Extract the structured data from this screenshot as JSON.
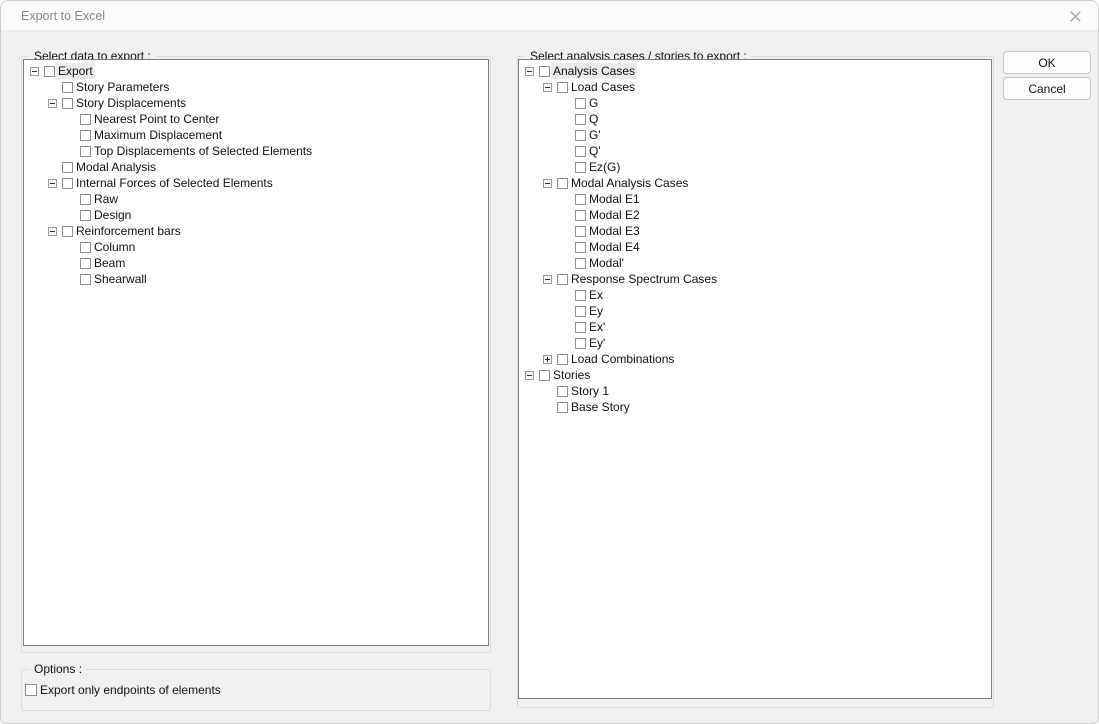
{
  "window": {
    "title": "Export to Excel",
    "close_icon": "close-icon"
  },
  "left_panel": {
    "legend": "Select data to export :",
    "tree": [
      {
        "label": "Export",
        "level": 0,
        "expander": "minus",
        "checked": false,
        "selected": true
      },
      {
        "label": "Story Parameters",
        "level": 1,
        "expander": "none",
        "checked": false,
        "selected": false
      },
      {
        "label": "Story Displacements",
        "level": 1,
        "expander": "minus",
        "checked": false,
        "selected": false
      },
      {
        "label": "Nearest Point to Center",
        "level": 2,
        "expander": "none",
        "checked": false,
        "selected": false
      },
      {
        "label": "Maximum Displacement",
        "level": 2,
        "expander": "none",
        "checked": false,
        "selected": false
      },
      {
        "label": "Top Displacements of Selected Elements",
        "level": 2,
        "expander": "none",
        "checked": false,
        "selected": false
      },
      {
        "label": "Modal Analysis",
        "level": 1,
        "expander": "none",
        "checked": false,
        "selected": false
      },
      {
        "label": "Internal Forces of Selected Elements",
        "level": 1,
        "expander": "minus",
        "checked": false,
        "selected": false
      },
      {
        "label": "Raw",
        "level": 2,
        "expander": "none",
        "checked": false,
        "selected": false
      },
      {
        "label": "Design",
        "level": 2,
        "expander": "none",
        "checked": false,
        "selected": false
      },
      {
        "label": "Reinforcement bars",
        "level": 1,
        "expander": "minus",
        "checked": false,
        "selected": false
      },
      {
        "label": "Column",
        "level": 2,
        "expander": "none",
        "checked": false,
        "selected": false
      },
      {
        "label": "Beam",
        "level": 2,
        "expander": "none",
        "checked": false,
        "selected": false
      },
      {
        "label": "Shearwall",
        "level": 2,
        "expander": "none",
        "checked": false,
        "selected": false
      }
    ]
  },
  "right_panel": {
    "legend": "Select analysis cases / stories to export :",
    "tree": [
      {
        "label": "Analysis Cases",
        "level": 0,
        "expander": "minus",
        "checked": false,
        "selected": true
      },
      {
        "label": "Load Cases",
        "level": 1,
        "expander": "minus",
        "checked": false,
        "selected": false
      },
      {
        "label": "G",
        "level": 2,
        "expander": "none",
        "checked": false,
        "selected": false
      },
      {
        "label": "Q",
        "level": 2,
        "expander": "none",
        "checked": false,
        "selected": false
      },
      {
        "label": "G'",
        "level": 2,
        "expander": "none",
        "checked": false,
        "selected": false
      },
      {
        "label": "Q'",
        "level": 2,
        "expander": "none",
        "checked": false,
        "selected": false
      },
      {
        "label": "Ez(G)",
        "level": 2,
        "expander": "none",
        "checked": false,
        "selected": false
      },
      {
        "label": "Modal Analysis Cases",
        "level": 1,
        "expander": "minus",
        "checked": false,
        "selected": false
      },
      {
        "label": "Modal E1",
        "level": 2,
        "expander": "none",
        "checked": false,
        "selected": false
      },
      {
        "label": "Modal E2",
        "level": 2,
        "expander": "none",
        "checked": false,
        "selected": false
      },
      {
        "label": "Modal E3",
        "level": 2,
        "expander": "none",
        "checked": false,
        "selected": false
      },
      {
        "label": "Modal E4",
        "level": 2,
        "expander": "none",
        "checked": false,
        "selected": false
      },
      {
        "label": "Modal'",
        "level": 2,
        "expander": "none",
        "checked": false,
        "selected": false
      },
      {
        "label": "Response Spectrum Cases",
        "level": 1,
        "expander": "minus",
        "checked": false,
        "selected": false
      },
      {
        "label": "Ex",
        "level": 2,
        "expander": "none",
        "checked": false,
        "selected": false
      },
      {
        "label": "Ey",
        "level": 2,
        "expander": "none",
        "checked": false,
        "selected": false
      },
      {
        "label": "Ex'",
        "level": 2,
        "expander": "none",
        "checked": false,
        "selected": false
      },
      {
        "label": "Ey'",
        "level": 2,
        "expander": "none",
        "checked": false,
        "selected": false
      },
      {
        "label": "Load Combinations",
        "level": 1,
        "expander": "plus",
        "checked": false,
        "selected": false
      },
      {
        "label": "Stories",
        "level": 0,
        "expander": "minus",
        "checked": false,
        "selected": false
      },
      {
        "label": "Story 1",
        "level": 1,
        "expander": "none",
        "checked": false,
        "selected": false
      },
      {
        "label": "Base Story",
        "level": 1,
        "expander": "none",
        "checked": false,
        "selected": false
      }
    ]
  },
  "options": {
    "legend": "Options :",
    "export_only_endpoints_label": "Export only endpoints of elements",
    "export_only_endpoints_checked": false
  },
  "buttons": {
    "ok_label": "OK",
    "cancel_label": "Cancel"
  },
  "colors": {
    "window_bg": "#f0f0f0",
    "titlebar_bg": "#fbfbfb",
    "tree_bg": "#ffffff",
    "tree_border": "#7a7f87",
    "group_border": "#dcdcdc",
    "title_text": "#8a8a8a",
    "expander_glyph": "#21315c",
    "selection_bg": "#ebebeb"
  }
}
